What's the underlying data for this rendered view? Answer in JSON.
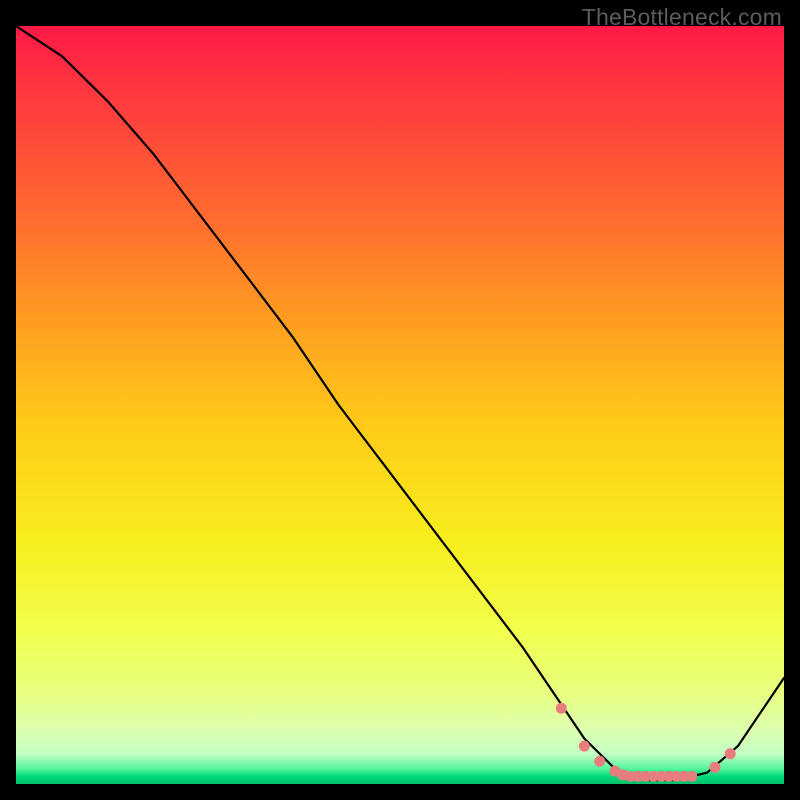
{
  "watermark": "TheBottleneck.com",
  "chart_data": {
    "type": "line",
    "title": "",
    "xlabel": "",
    "ylabel": "",
    "xlim": [
      0,
      100
    ],
    "ylim": [
      0,
      100
    ],
    "series": [
      {
        "name": "curve",
        "x": [
          0,
          6,
          12,
          18,
          24,
          30,
          36,
          42,
          48,
          54,
          60,
          66,
          70,
          74,
          78,
          82,
          86,
          90,
          94,
          100
        ],
        "y": [
          100,
          96,
          90,
          83,
          75,
          67,
          59,
          50,
          42,
          34,
          26,
          18,
          12,
          6,
          2,
          0.5,
          0.5,
          1.5,
          5,
          14
        ]
      }
    ],
    "markers": {
      "name": "dots",
      "x": [
        71,
        74,
        76,
        78,
        79,
        80,
        81,
        82,
        83,
        84,
        85,
        86,
        87,
        88,
        91,
        93
      ],
      "y": [
        10,
        5,
        3,
        1.7,
        1.2,
        1,
        1,
        1,
        1,
        1,
        1,
        1,
        1,
        1,
        2.2,
        4
      ]
    }
  }
}
